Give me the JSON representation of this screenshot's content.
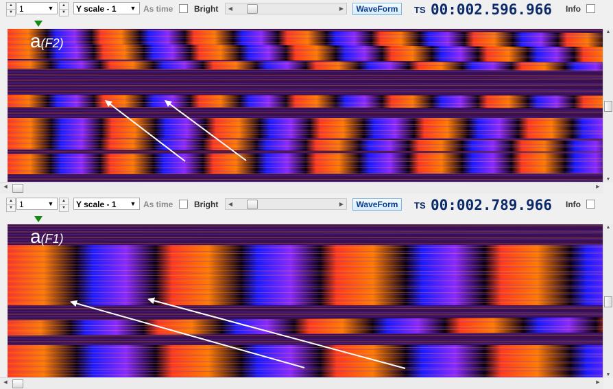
{
  "panels": [
    {
      "id": "top",
      "channel_value": "1",
      "yscale_value": "Y scale - 1",
      "as_time_label": "As time",
      "bright_label": "Bright",
      "waveform_label": "WaveForm",
      "ts_label": "TS",
      "timestamp": "00:002.596.966",
      "info_label": "Info",
      "frame_letter": "a",
      "frame_name": "(F2)",
      "arrow_count": 2
    },
    {
      "id": "bottom",
      "channel_value": "1",
      "yscale_value": "Y scale - 1",
      "as_time_label": "As time",
      "bright_label": "Bright",
      "waveform_label": "WaveForm",
      "ts_label": "TS",
      "timestamp": "00:002.789.966",
      "info_label": "Info",
      "frame_letter": "a",
      "frame_name": "(F1)",
      "arrow_count": 2
    }
  ],
  "icons": {
    "spin": "spin-up-down-icon",
    "dropdown": "chevron-down-icon",
    "slider_left": "arrow-left-icon",
    "slider_right": "arrow-right-icon",
    "position_marker": "triangle-down-icon",
    "annotation_arrow": "arrow-icon"
  },
  "colors": {
    "background": "#f0f0f0",
    "heat_red": "#ff3a1a",
    "heat_orange": "#ff7a00",
    "heat_blue": "#1a1aff",
    "heat_violet": "#8a2aff",
    "heat_black": "#0a0010",
    "ts_text": "#0a2a6a",
    "marker_green": "#138a13",
    "arrow_white": "#ffffff"
  }
}
